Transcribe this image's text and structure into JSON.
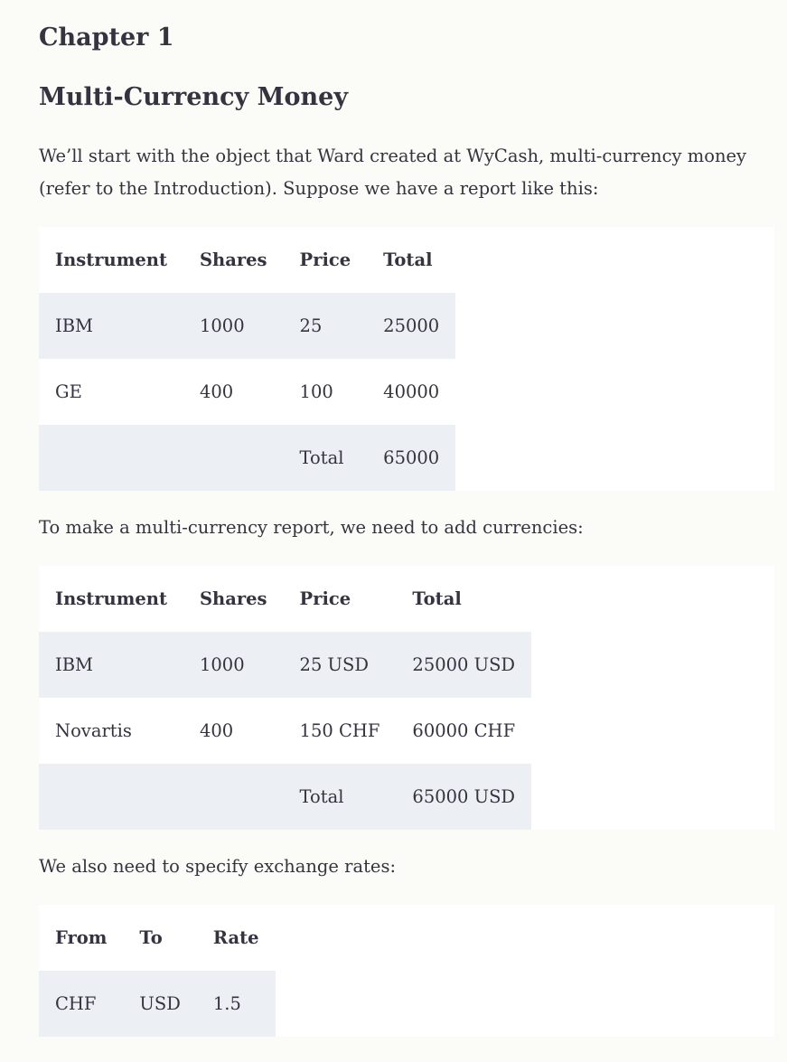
{
  "chapter": "Chapter 1",
  "title": "Multi-Currency Money",
  "paragraphs": {
    "intro": "We’ll start with the object that Ward created at WyCash, multi-currency money (refer to the Introduction). Suppose we have a report like this:",
    "currencies": "To make a multi-currency report, we need to add currencies:",
    "rates": "We also need to specify exchange rates:"
  },
  "table1": {
    "headers": [
      "Instrument",
      "Shares",
      "Price",
      "Total"
    ],
    "rows": [
      [
        "IBM",
        "1000",
        "25",
        "25000"
      ],
      [
        "GE",
        "400",
        "100",
        "40000"
      ],
      [
        "",
        "",
        "Total",
        "65000"
      ]
    ]
  },
  "table2": {
    "headers": [
      "Instrument",
      "Shares",
      "Price",
      "Total"
    ],
    "rows": [
      [
        "IBM",
        "1000",
        "25 USD",
        "25000 USD"
      ],
      [
        "Novartis",
        "400",
        "150 CHF",
        "60000 CHF"
      ],
      [
        "",
        "",
        "Total",
        "65000 USD"
      ]
    ]
  },
  "table3": {
    "headers": [
      "From",
      "To",
      "Rate"
    ],
    "rows": [
      [
        "CHF",
        "USD",
        "1.5"
      ]
    ]
  }
}
